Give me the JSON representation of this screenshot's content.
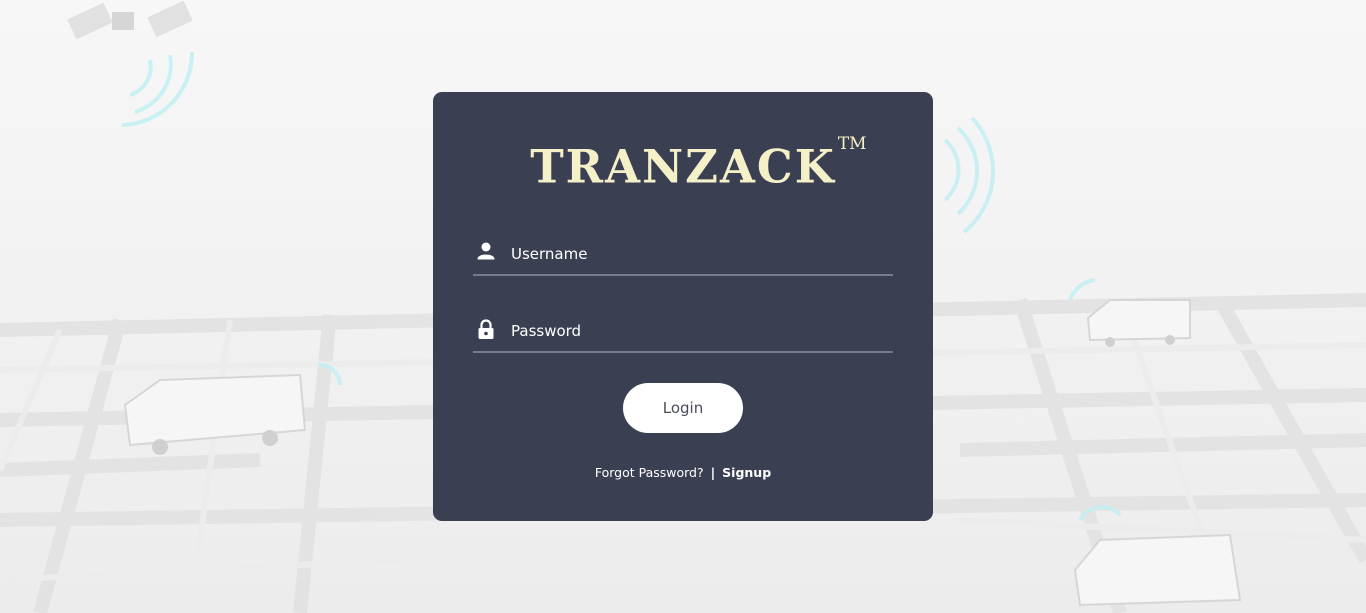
{
  "brand": {
    "name": "TRANZACK",
    "trademark": "TM"
  },
  "login_form": {
    "username": {
      "placeholder": "Username",
      "value": "",
      "icon": "user-icon"
    },
    "password": {
      "placeholder": "Password",
      "value": "",
      "icon": "lock-icon"
    },
    "login_label": "Login",
    "forgot_password_label": "Forgot Password?",
    "separator": "|",
    "signup_label": "Signup"
  },
  "colors": {
    "card_background": "#3b3f52",
    "logo_text": "#f4f0c8",
    "button_background": "#ffffff",
    "field_underline": "#767a8c",
    "background_accent": "#bfeff2"
  }
}
